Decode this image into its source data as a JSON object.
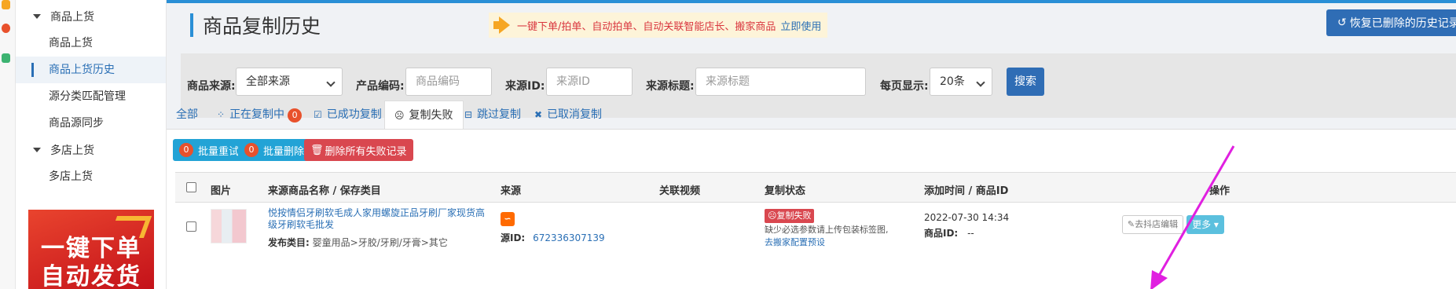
{
  "sidebar": {
    "groups": [
      {
        "label": "商品上货",
        "items": [
          {
            "label": "商品上货"
          },
          {
            "label": "商品上货历史"
          },
          {
            "label": "源分类匹配管理"
          },
          {
            "label": "商品源同步"
          }
        ]
      },
      {
        "label": "多店上货",
        "items": [
          {
            "label": "多店上货"
          }
        ]
      }
    ],
    "active_item": "商品上货历史",
    "ad": {
      "line1": "一键下单",
      "line2": "自动发货"
    }
  },
  "header": {
    "title": "商品复制历史",
    "promo_text": "一键下单/拍单、自动拍单、自动关联智能店长、搬家商品",
    "promo_link": "立即使用",
    "restore_button": "恢复已删除的历史记录"
  },
  "filters": {
    "source_label": "商品来源:",
    "source_value": "全部来源",
    "code_label": "产品编码:",
    "code_placeholder": "商品编码",
    "source_id_label": "来源ID:",
    "source_id_placeholder": "来源ID",
    "source_title_label": "来源标题:",
    "source_title_placeholder": "来源标题",
    "per_page_label": "每页显示:",
    "per_page_value": "20条",
    "search_button": "搜索"
  },
  "tabs": [
    {
      "label": "全部",
      "icon": ""
    },
    {
      "label": "正在复制中",
      "icon": "spinner-icon",
      "count": "0"
    },
    {
      "label": "已成功复制",
      "icon": "check-square-icon"
    },
    {
      "label": "复制失败",
      "icon": "frown-icon"
    },
    {
      "label": "跳过复制",
      "icon": "minus-square-icon"
    },
    {
      "label": "已取消复制",
      "icon": "close-icon"
    }
  ],
  "active_tab": "复制失败",
  "actions": {
    "retry_count": "0",
    "retry_label": "批量重试",
    "delete_count": "0",
    "delete_label": "批量删除",
    "delete_all_label": "删除所有失败记录"
  },
  "table": {
    "headers": [
      "图片",
      "来源商品名称 / 保存类目",
      "来源",
      "关联视频",
      "复制状态",
      "添加时间 / 商品ID",
      "操作"
    ],
    "rows": [
      {
        "name": "悦按情侣牙刷软毛成人家用螺旋正品牙刷厂家现货高级牙刷软毛批发",
        "category_label": "发布类目:",
        "category": "婴童用品>牙胶/牙刷/牙膏>其它",
        "source_id_label": "源ID:",
        "source_id": "672336307139",
        "status": "复制失败",
        "status_msg": "缺少必选参数请上传包装标签图,",
        "status_link": "去搬家配置预设",
        "time": "2022-07-30 14:34",
        "goods_id_label": "商品ID:",
        "goods_id": "--",
        "edit_label": "去抖店编辑",
        "more_label": "更多"
      }
    ]
  },
  "colors": {
    "primary": "#2f6db5",
    "danger": "#d9474f",
    "info": "#22a3d6",
    "badge": "#e8512c",
    "arrow": "#e020e0"
  }
}
